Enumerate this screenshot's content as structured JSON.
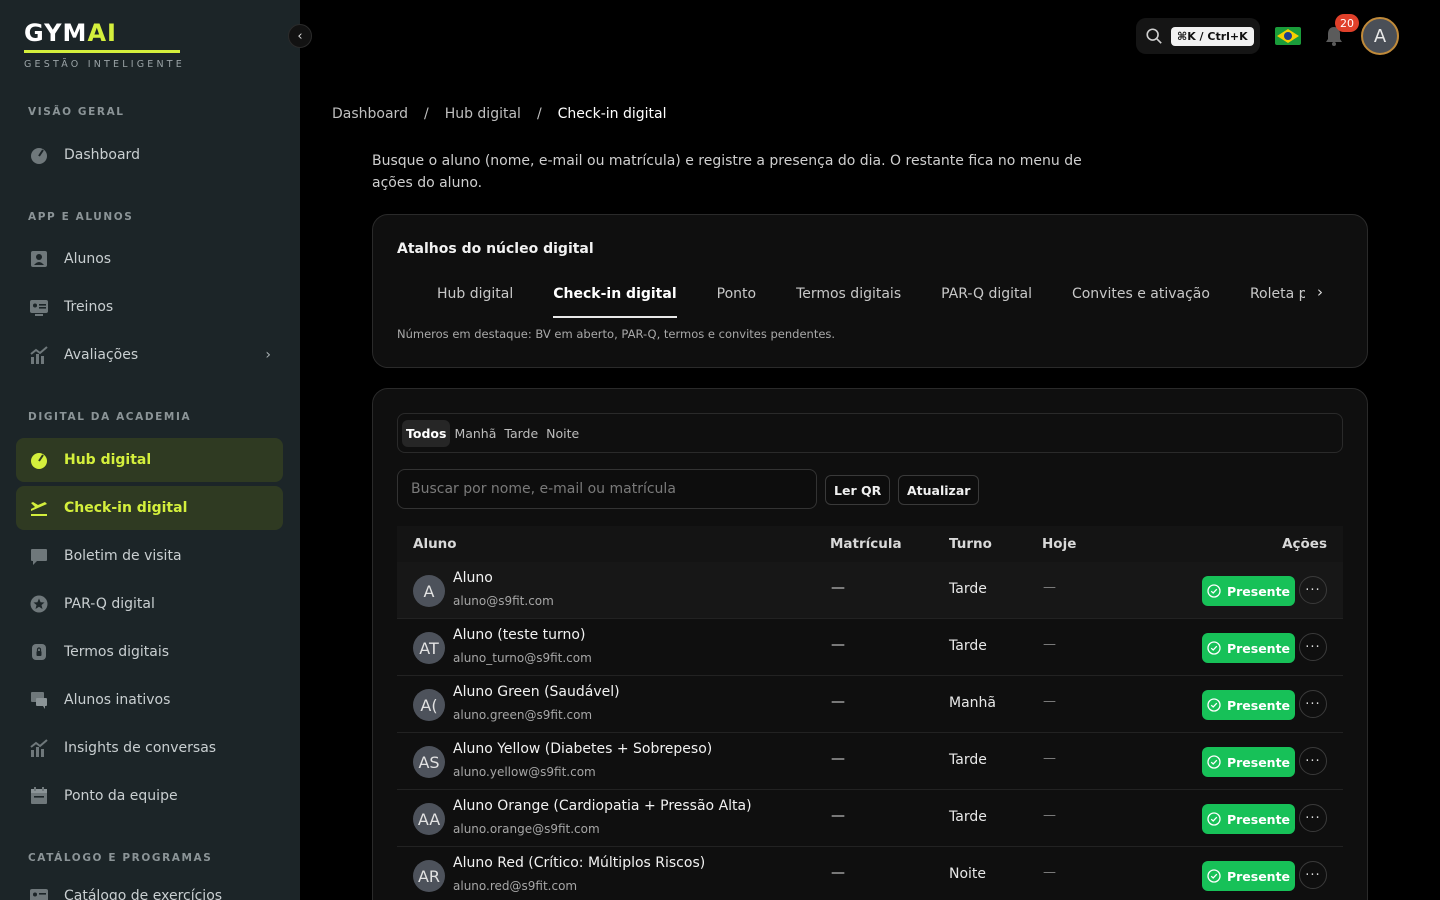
{
  "brand": {
    "name_a": "GYM",
    "name_b": "AI",
    "tagline": "GESTÃO INTELIGENTE",
    "accent": "#d4ef3c"
  },
  "sidebar": {
    "sections": [
      {
        "title": "VISÃO GERAL"
      },
      {
        "title": "APP E ALUNOS"
      },
      {
        "title": "DIGITAL DA ACADEMIA"
      },
      {
        "title": "CATÁLOGO E PROGRAMAS"
      }
    ],
    "items": [
      {
        "label": "Dashboard",
        "icon": "gauge-icon"
      },
      {
        "label": "Alunos",
        "icon": "user-icon"
      },
      {
        "label": "Treinos",
        "icon": "id-card-icon"
      },
      {
        "label": "Avaliações",
        "icon": "chart-icon"
      },
      {
        "label": "Hub digital",
        "icon": "gauge-icon",
        "active": true
      },
      {
        "label": "Check-in digital",
        "icon": "plane-icon",
        "active": true
      },
      {
        "label": "Boletim de visita",
        "icon": "message-icon"
      },
      {
        "label": "PAR-Q digital",
        "icon": "star-icon"
      },
      {
        "label": "Termos digitais",
        "icon": "lock-icon"
      },
      {
        "label": "Alunos inativos",
        "icon": "chat-icon"
      },
      {
        "label": "Insights de conversas",
        "icon": "chart-icon"
      },
      {
        "label": "Ponto da equipe",
        "icon": "calendar-icon"
      },
      {
        "label": "Catálogo de exercícios",
        "icon": "id-card-icon"
      }
    ]
  },
  "topbar": {
    "shortcut": "⌘K / Ctrl+K",
    "notifications": "20",
    "avatar_initial": "A"
  },
  "breadcrumb": [
    "Dashboard",
    "Hub digital",
    "Check-in digital"
  ],
  "intro": "Busque o aluno (nome, e-mail ou matrícula) e registre a presença do dia. O restante fica no menu de ações do aluno.",
  "shortcuts": {
    "title": "Atalhos do núcleo digital",
    "tabs": [
      "Hub digital",
      "Check-in digital",
      "Ponto",
      "Termos digitais",
      "PAR-Q digital",
      "Convites e ativação",
      "Roleta pós-v"
    ],
    "active_tab": 1,
    "note": "Números em destaque: BV em aberto, PAR-Q, termos e convites pendentes."
  },
  "filters": {
    "segments": [
      "Todos",
      "Manhã",
      "Tarde",
      "Noite"
    ],
    "active": 0
  },
  "search": {
    "placeholder": "Buscar por nome, e-mail ou matrícula",
    "qr_label": "Ler QR",
    "refresh_label": "Atualizar"
  },
  "table": {
    "headers": {
      "aluno": "Aluno",
      "matricula": "Matrícula",
      "turno": "Turno",
      "hoje": "Hoje",
      "acoes": "Ações"
    },
    "action_label": "Presente",
    "rows": [
      {
        "initials": "A",
        "name": "Aluno",
        "email": "aluno@s9fit.com",
        "matricula": "—",
        "turno": "Tarde",
        "hoje": "—"
      },
      {
        "initials": "AT",
        "name": "Aluno (teste turno)",
        "email": "aluno_turno@s9fit.com",
        "matricula": "—",
        "turno": "Tarde",
        "hoje": "—"
      },
      {
        "initials": "A(",
        "name": "Aluno Green (Saudável)",
        "email": "aluno.green@s9fit.com",
        "matricula": "—",
        "turno": "Manhã",
        "hoje": "—"
      },
      {
        "initials": "AS",
        "name": "Aluno Yellow (Diabetes + Sobrepeso)",
        "email": "aluno.yellow@s9fit.com",
        "matricula": "—",
        "turno": "Tarde",
        "hoje": "—"
      },
      {
        "initials": "AA",
        "name": "Aluno Orange (Cardiopatia + Pressão Alta)",
        "email": "aluno.orange@s9fit.com",
        "matricula": "—",
        "turno": "Tarde",
        "hoje": "—"
      },
      {
        "initials": "AR",
        "name": "Aluno Red (Crítico: Múltiplos Riscos)",
        "email": "aluno.red@s9fit.com",
        "matricula": "—",
        "turno": "Noite",
        "hoje": "—"
      }
    ]
  },
  "colors": {
    "success": "#17c158",
    "sidebar_bg": "#1c2528",
    "active_bg": "#2f3a22"
  }
}
